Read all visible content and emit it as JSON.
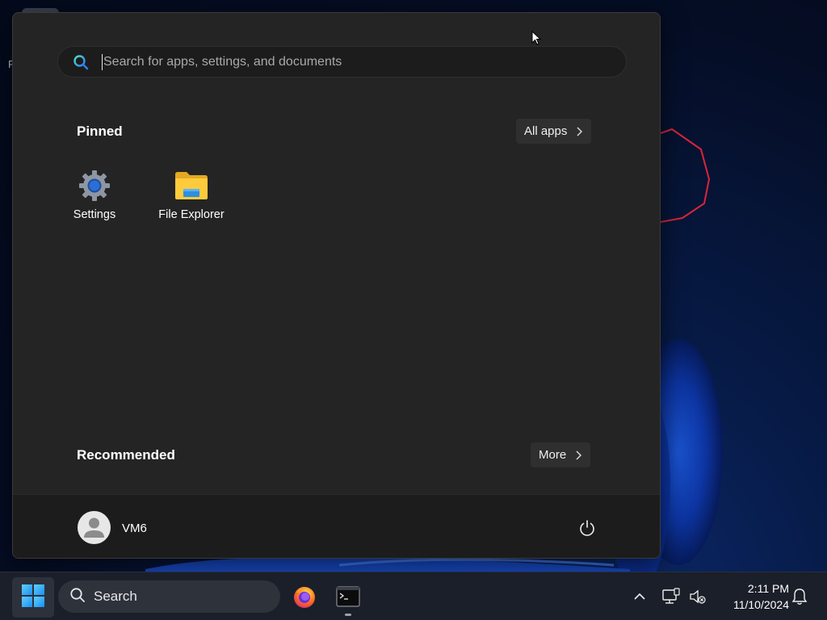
{
  "start_menu": {
    "search": {
      "placeholder": "Search for apps, settings, and documents",
      "value": ""
    },
    "pinned": {
      "title": "Pinned",
      "all_apps_label": "All apps",
      "apps": [
        {
          "label": "Settings",
          "icon": "settings-gear-icon"
        },
        {
          "label": "File Explorer",
          "icon": "folder-icon"
        }
      ]
    },
    "recommended": {
      "title": "Recommended",
      "more_label": "More"
    },
    "user": {
      "name": "VM6",
      "avatar_icon": "user-avatar-icon"
    },
    "power_icon": "power-icon"
  },
  "taskbar": {
    "start_icon": "windows-logo-icon",
    "search_label": "Search",
    "apps": [
      {
        "name": "Firefox",
        "icon": "firefox-icon"
      },
      {
        "name": "Terminal",
        "icon": "terminal-icon",
        "running": true
      }
    ],
    "tray": {
      "chevron_icon": "chevron-up-icon",
      "network_icon": "network-icon",
      "volume_icon": "volume-muted-icon",
      "notifications_icon": "bell-icon"
    },
    "clock": {
      "time": "2:11 PM",
      "date": "11/10/2024"
    }
  },
  "colors": {
    "menu_bg": "#242424",
    "user_bar_bg": "#1c1c1c",
    "taskbar_bg": "#1b1f29",
    "accent_blue": "#3aa0f2",
    "annotation_red": "#d9263a"
  }
}
